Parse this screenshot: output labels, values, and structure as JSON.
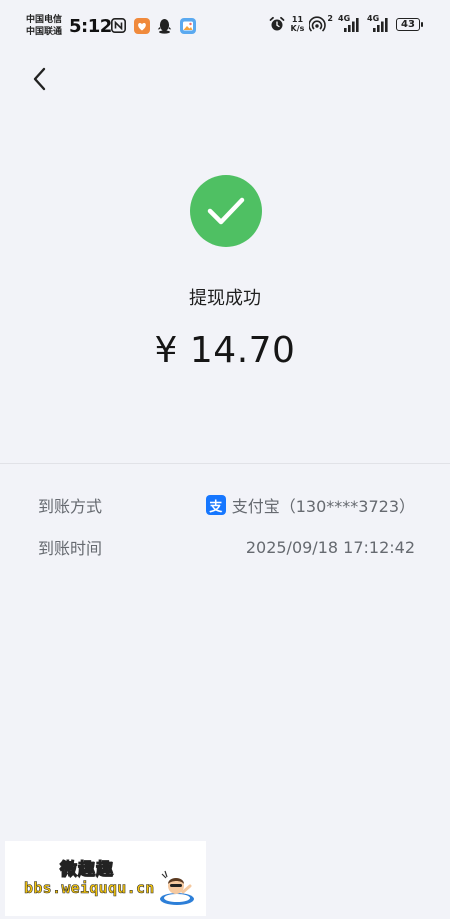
{
  "status_bar": {
    "carrier_1": "中国电信",
    "carrier_2": "中国联通",
    "time": "5:12",
    "net_speed_value": "11",
    "net_speed_unit": "K/s",
    "hd_label": "2",
    "signal_1_label": "4G",
    "signal_2_label": "4G",
    "battery_level": "43"
  },
  "result": {
    "status_text": "提现成功",
    "amount": "¥ 14.70",
    "success_color": "#4fc063"
  },
  "details": {
    "method_label": "到账方式",
    "method_icon_glyph": "支",
    "method_value": "支付宝（130****3723）",
    "time_label": "到账时间",
    "time_value": "2025/09/18 17:12:42"
  },
  "watermark": {
    "title": "微趣趣",
    "url": "bbs.weiququ.cn"
  },
  "colors": {
    "background": "#f2f3f8",
    "alipay_blue": "#1677ff",
    "label_gray": "#666a70"
  }
}
